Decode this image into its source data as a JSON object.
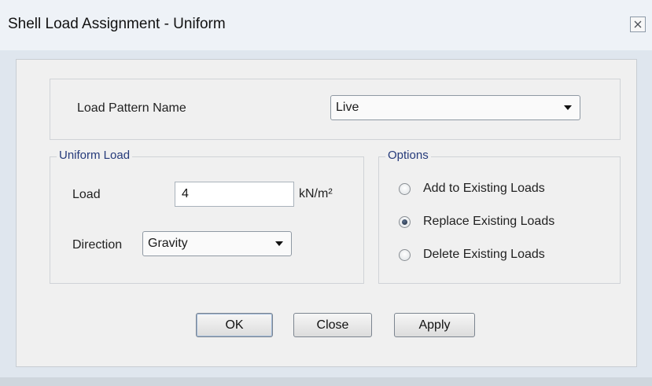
{
  "window": {
    "title": "Shell Load Assignment - Uniform",
    "close_icon": "close-icon"
  },
  "load_pattern": {
    "label": "Load Pattern Name",
    "selected": "Live"
  },
  "uniform_load": {
    "legend": "Uniform Load",
    "load_label": "Load",
    "load_value": "4",
    "unit": "kN/m²",
    "direction_label": "Direction",
    "direction_selected": "Gravity"
  },
  "options": {
    "legend": "Options",
    "items": [
      {
        "label": "Add to Existing Loads",
        "checked": false
      },
      {
        "label": "Replace Existing Loads",
        "checked": true
      },
      {
        "label": "Delete Existing Loads",
        "checked": false
      }
    ]
  },
  "buttons": {
    "ok": "OK",
    "close": "Close",
    "apply": "Apply"
  }
}
